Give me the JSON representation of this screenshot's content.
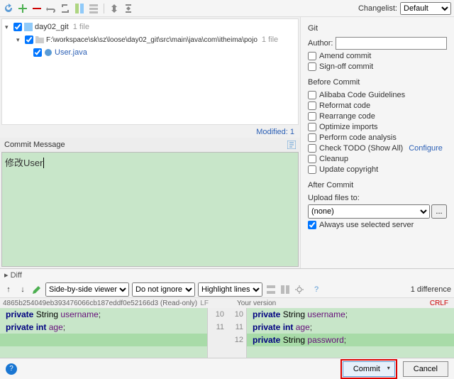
{
  "toolbar": {
    "changelist_label": "Changelist:",
    "changelist_value": "Default"
  },
  "tree": {
    "root": {
      "label": "day02_git",
      "count": "1 file"
    },
    "path": {
      "label": "F:\\workspace\\sk\\sz\\loose\\day02_git\\src\\main\\java\\com\\itheima\\pojo",
      "count": "1 file"
    },
    "file": {
      "label": "User.java"
    }
  },
  "modified_label": "Modified: 1",
  "commit_message_label": "Commit Message",
  "commit_message_value": "修改User",
  "git": {
    "section": "Git",
    "author_label": "Author:",
    "amend": "Amend commit",
    "signoff": "Sign-off commit"
  },
  "before": {
    "section": "Before Commit",
    "alibaba": "Alibaba Code Guidelines",
    "reformat": "Reformat code",
    "rearrange": "Rearrange code",
    "optimize": "Optimize imports",
    "analysis": "Perform code analysis",
    "todo": "Check TODO (Show All)",
    "configure": "Configure",
    "cleanup": "Cleanup",
    "copyright": "Update copyright"
  },
  "after": {
    "section": "After Commit",
    "upload_label": "Upload files to:",
    "upload_value": "(none)",
    "always": "Always use selected server"
  },
  "diff_header": "Diff",
  "diff": {
    "viewer": "Side-by-side viewer",
    "ignore": "Do not ignore",
    "highlight": "Highlight lines",
    "count": "1 difference",
    "hash": "4865b254049eb393476066cb187eddf0e52166d3 (Read-only)",
    "lf": "LF",
    "your_version": "Your version",
    "crlf": "CRLF",
    "left_lines": [
      {
        "n": "10",
        "code": "private String username;"
      },
      {
        "n": "11",
        "code": "private int age;"
      },
      {
        "n": "",
        "code": ""
      }
    ],
    "right_lines": [
      {
        "n": "10",
        "code": "private String username;"
      },
      {
        "n": "11",
        "code": "private int age;"
      },
      {
        "n": "12",
        "code": "private String password;",
        "added": true
      }
    ]
  },
  "buttons": {
    "commit": "Commit",
    "cancel": "Cancel"
  }
}
